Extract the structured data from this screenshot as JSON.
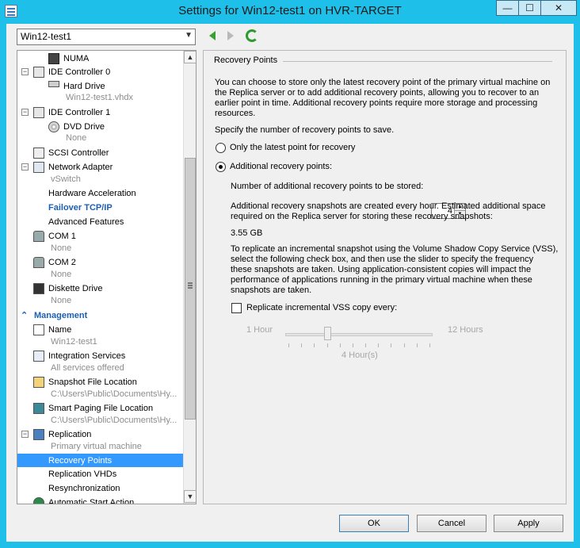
{
  "window": {
    "title": "Settings for Win12-test1 on HVR-TARGET",
    "minimize": "—",
    "maximize": "☐",
    "close": "✕"
  },
  "vm_selector": {
    "value": "Win12-test1"
  },
  "tree": {
    "hardware": [
      {
        "label": "NUMA",
        "icon": "numa-icon"
      },
      {
        "label": "IDE Controller 0",
        "icon": "ide-controller-icon"
      },
      {
        "label": "Hard Drive",
        "sub": "Win12-test1.vhdx",
        "icon": "hard-drive-icon"
      },
      {
        "label": "IDE Controller 1",
        "icon": "ide-controller-icon"
      },
      {
        "label": "DVD Drive",
        "sub": "None",
        "icon": "dvd-icon"
      },
      {
        "label": "SCSI Controller",
        "icon": "scsi-icon"
      },
      {
        "label": "Network Adapter",
        "sub": "vSwitch",
        "icon": "network-adapter-icon"
      },
      {
        "label": "Hardware Acceleration"
      },
      {
        "label": "Failover TCP/IP"
      },
      {
        "label": "Advanced Features"
      },
      {
        "label": "COM 1",
        "sub": "None",
        "icon": "com-port-icon"
      },
      {
        "label": "COM 2",
        "sub": "None",
        "icon": "com-port-icon"
      },
      {
        "label": "Diskette Drive",
        "sub": "None",
        "icon": "floppy-icon"
      }
    ],
    "management_header": "Management",
    "management": [
      {
        "label": "Name",
        "sub": "Win12-test1"
      },
      {
        "label": "Integration Services",
        "sub": "All services offered"
      },
      {
        "label": "Snapshot File Location",
        "sub": "C:\\Users\\Public\\Documents\\Hy..."
      },
      {
        "label": "Smart Paging File Location",
        "sub": "C:\\Users\\Public\\Documents\\Hy..."
      },
      {
        "label": "Replication",
        "sub": "Primary virtual machine"
      },
      {
        "label": "Recovery Points"
      },
      {
        "label": "Replication VHDs"
      },
      {
        "label": "Resynchronization"
      },
      {
        "label": "Automatic Start Action"
      }
    ]
  },
  "panel": {
    "group_title": "Recovery Points",
    "intro": [
      "You can choose to store only the latest recovery point of the primary virtual machine on",
      "the Replica server or to add additional recovery points, allowing you to recover to an",
      "earlier point in time. Additional recovery points require more storage and processing",
      "resources."
    ],
    "specify": "Specify the number of recovery points to save.",
    "radio_latest": "Only the latest point for recovery",
    "radio_additional": "Additional recovery points:",
    "num_label": "Number of additional recovery points to be stored:",
    "num_value": "4",
    "estimate": [
      "Additional recovery snapshots are created every hour. Estimated additional space",
      "required on the Replica server for storing these recovery snapshots:"
    ],
    "size": "3.55 GB",
    "vss_text": [
      "To replicate an incremental snapshot using the Volume Shadow Copy Service (VSS),",
      "select the following check box, and then use the slider to specify the frequency",
      "these snapshots are taken. Using application-consistent copies will impact the",
      "performance of applications running in the primary virtual machine when these",
      "snapshots are taken."
    ],
    "vss_checkbox": "Replicate incremental VSS copy every:",
    "slider_min": "1 Hour",
    "slider_max": "12 Hours",
    "slider_value": "4 Hour(s)",
    "slider_level": 4
  },
  "buttons": {
    "ok": "OK",
    "cancel": "Cancel",
    "apply": "Apply"
  }
}
